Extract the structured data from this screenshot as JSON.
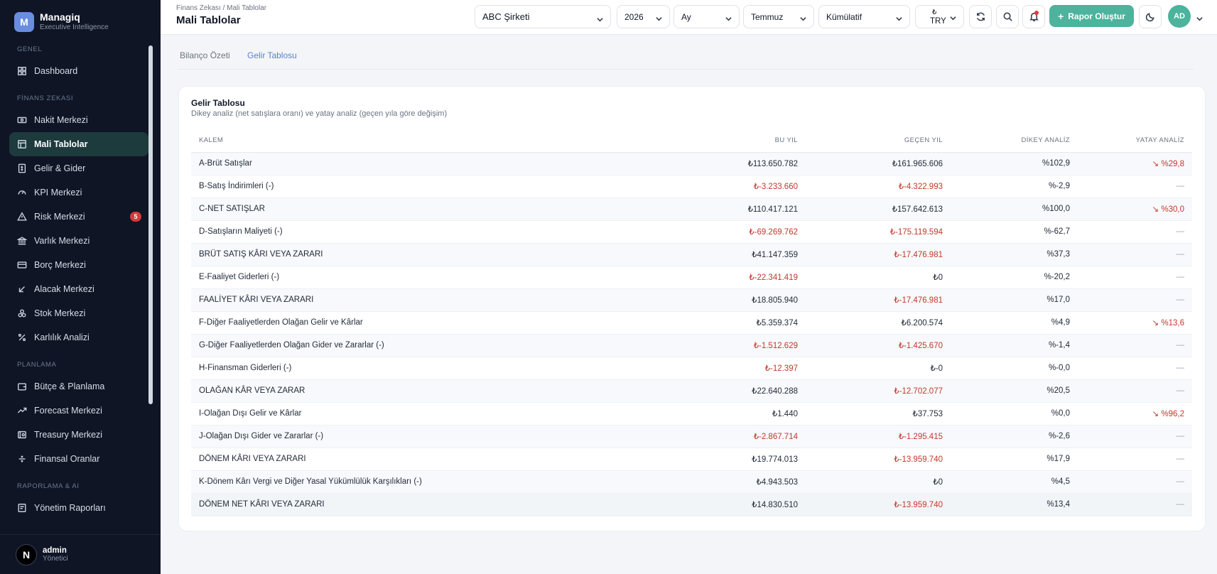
{
  "sidebar": {
    "brand": {
      "logo_letter": "M",
      "name": "Managiq",
      "subtitle": "Executive Intelligence"
    },
    "sections": [
      {
        "title": "GENEL",
        "items": [
          {
            "label": "Dashboard",
            "icon": "dashboard-icon"
          }
        ]
      },
      {
        "title": "FİNANS ZEKASI",
        "items": [
          {
            "label": "Nakit Merkezi",
            "icon": "cash-icon"
          },
          {
            "label": "Mali Tablolar",
            "icon": "table-icon",
            "active": true
          },
          {
            "label": "Gelir & Gider",
            "icon": "receipt-icon"
          },
          {
            "label": "KPI Merkezi",
            "icon": "gauge-icon"
          },
          {
            "label": "Risk Merkezi",
            "icon": "warning-icon",
            "badge": "5"
          },
          {
            "label": "Varlık Merkezi",
            "icon": "bank-icon"
          },
          {
            "label": "Borç Merkezi",
            "icon": "credit-card-icon"
          },
          {
            "label": "Alacak Merkezi",
            "icon": "arrow-down-left-icon"
          },
          {
            "label": "Stok Merkezi",
            "icon": "boxes-icon"
          },
          {
            "label": "Karlılık Analizi",
            "icon": "percent-icon"
          }
        ]
      },
      {
        "title": "PLANLAMA",
        "items": [
          {
            "label": "Bütçe & Planlama",
            "icon": "wallet-icon"
          },
          {
            "label": "Forecast Merkezi",
            "icon": "trending-up-icon"
          },
          {
            "label": "Treasury Merkezi",
            "icon": "vault-icon"
          },
          {
            "label": "Finansal Oranlar",
            "icon": "divide-icon"
          }
        ]
      },
      {
        "title": "RAPORLAMA & AI",
        "items": [
          {
            "label": "Yönetim Raporları",
            "icon": "report-icon"
          }
        ]
      }
    ],
    "user": {
      "initial": "N",
      "name": "admin",
      "role": "Yönetici"
    }
  },
  "header": {
    "breadcrumb": "Finans Zekası / Mali Tablolar",
    "title": "Mali Tablolar",
    "company": "ABC Şirketi",
    "year": "2026",
    "period_type": "Ay",
    "month": "Temmuz",
    "mode": "Kümülatif",
    "currency_symbol": "₺",
    "currency": "TRY",
    "report_button": "Rapor Oluştur",
    "avatar": "AD"
  },
  "tabs": [
    {
      "label": "Bilanço Özeti",
      "active": false
    },
    {
      "label": "Gelir Tablosu",
      "active": true
    }
  ],
  "card": {
    "title": "Gelir Tablosu",
    "subtitle": "Dikey analiz (net satışlara oranı) ve yatay analiz (geçen yıla göre değişim)",
    "columns": [
      "KALEM",
      "BU YIL",
      "GEÇEN YIL",
      "DİKEY ANALİZ",
      "YATAY ANALİZ"
    ],
    "rows": [
      {
        "item": "A-Brüt Satışlar",
        "current": "₺113.650.782",
        "previous": "₺161.965.606",
        "vertical": "%102,9",
        "horizontal": "↘ %29,8"
      },
      {
        "item": "B-Satış İndirimleri (-)",
        "current": "₺-3.233.660",
        "previous": "₺-4.322.993",
        "vertical": "%-2,9",
        "horizontal": "—"
      },
      {
        "item": "C-NET SATIŞLAR",
        "current": "₺110.417.121",
        "previous": "₺157.642.613",
        "vertical": "%100,0",
        "horizontal": "↘ %30,0"
      },
      {
        "item": "D-Satışların Maliyeti (-)",
        "current": "₺-69.269.762",
        "previous": "₺-175.119.594",
        "vertical": "%-62,7",
        "horizontal": "—"
      },
      {
        "item": "BRÜT SATIŞ KÂRI VEYA ZARARI",
        "current": "₺41.147.359",
        "previous": "₺-17.476.981",
        "vertical": "%37,3",
        "horizontal": "—"
      },
      {
        "item": "E-Faaliyet Giderleri (-)",
        "current": "₺-22.341.419",
        "previous": "₺0",
        "vertical": "%-20,2",
        "horizontal": "—"
      },
      {
        "item": "FAALİYET KÂRI VEYA ZARARI",
        "current": "₺18.805.940",
        "previous": "₺-17.476.981",
        "vertical": "%17,0",
        "horizontal": "—"
      },
      {
        "item": "F-Diğer Faaliyetlerden Olağan Gelir ve Kârlar",
        "current": "₺5.359.374",
        "previous": "₺6.200.574",
        "vertical": "%4,9",
        "horizontal": "↘ %13,6"
      },
      {
        "item": "G-Diğer Faaliyetlerden Olağan Gider ve Zararlar (-)",
        "current": "₺-1.512.629",
        "previous": "₺-1.425.670",
        "vertical": "%-1,4",
        "horizontal": "—"
      },
      {
        "item": "H-Finansman Giderleri (-)",
        "current": "₺-12.397",
        "previous": "₺-0",
        "vertical": "%-0,0",
        "horizontal": "—"
      },
      {
        "item": "OLAĞAN KÂR VEYA ZARAR",
        "current": "₺22.640.288",
        "previous": "₺-12.702.077",
        "vertical": "%20,5",
        "horizontal": "—"
      },
      {
        "item": "I-Olağan Dışı Gelir ve Kârlar",
        "current": "₺1.440",
        "previous": "₺37.753",
        "vertical": "%0,0",
        "horizontal": "↘ %96,2"
      },
      {
        "item": "J-Olağan Dışı Gider ve Zararlar (-)",
        "current": "₺-2.867.714",
        "previous": "₺-1.295.415",
        "vertical": "%-2,6",
        "horizontal": "—"
      },
      {
        "item": "DÖNEM KÂRI VEYA ZARARI",
        "current": "₺19.774.013",
        "previous": "₺-13.959.740",
        "vertical": "%17,9",
        "horizontal": "—"
      },
      {
        "item": "K-Dönem Kârı Vergi ve Diğer Yasal Yükümlülük Karşılıkları (-)",
        "current": "₺4.943.503",
        "previous": "₺0",
        "vertical": "%4,5",
        "horizontal": "—"
      },
      {
        "item": "DÖNEM NET KÂRI VEYA ZARARI",
        "current": "₺14.830.510",
        "previous": "₺-13.959.740",
        "vertical": "%13,4",
        "horizontal": "—"
      }
    ]
  }
}
